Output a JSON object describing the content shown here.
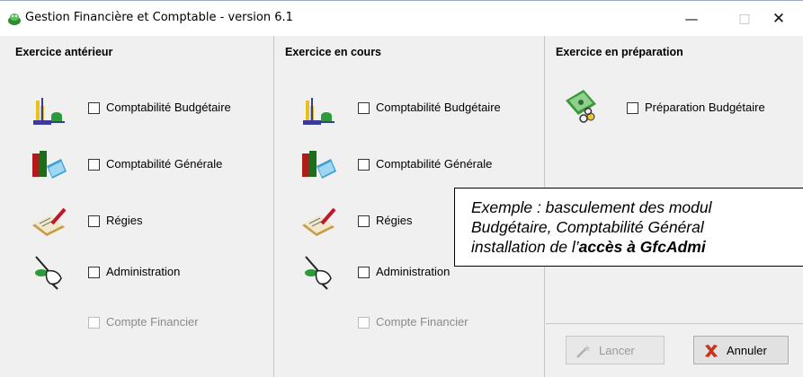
{
  "window": {
    "title": "Gestion Financière et Comptable - version 6.1",
    "minimize_glyph": "—",
    "maximize_glyph": "□",
    "close_glyph": "✕"
  },
  "columns": {
    "previous": {
      "header": "Exercice antérieur",
      "items": [
        {
          "label": "Comptabilité Budgétaire",
          "icon": "budget-scale-icon",
          "enabled": true
        },
        {
          "label": "Comptabilité Générale",
          "icon": "books-icon",
          "enabled": true
        },
        {
          "label": "Régies",
          "icon": "writing-pad-icon",
          "enabled": true
        },
        {
          "label": "Administration",
          "icon": "hand-wand-icon",
          "enabled": true
        },
        {
          "label": "Compte Financier",
          "icon": "",
          "enabled": false
        }
      ]
    },
    "current": {
      "header": "Exercice en cours",
      "items": [
        {
          "label": "Comptabilité Budgétaire",
          "icon": "budget-scale-icon",
          "enabled": true
        },
        {
          "label": "Comptabilité Générale",
          "icon": "books-icon",
          "enabled": true
        },
        {
          "label": "Régies",
          "icon": "writing-pad-icon",
          "enabled": true
        },
        {
          "label": "Administration",
          "icon": "hand-wand-icon",
          "enabled": true
        },
        {
          "label": "Compte Financier",
          "icon": "",
          "enabled": false
        }
      ]
    },
    "preparation": {
      "header": "Exercice en préparation",
      "items": [
        {
          "label": "Préparation Budgétaire",
          "icon": "money-coins-icon",
          "enabled": true
        }
      ],
      "buttons": {
        "launch_label": "Lancer",
        "cancel_label": "Annuler"
      }
    }
  },
  "annotation": {
    "line1": "Exemple : basculement des modul",
    "line2": "Budgétaire, Comptabilité Général",
    "line3_prefix": "installation de l’",
    "line3_bold": "accès à GfcAdmi"
  },
  "colors": {
    "window_bg": "#f0f0f0",
    "disabled_text": "#8a8a8a",
    "cancel_x": "#c8341e"
  }
}
